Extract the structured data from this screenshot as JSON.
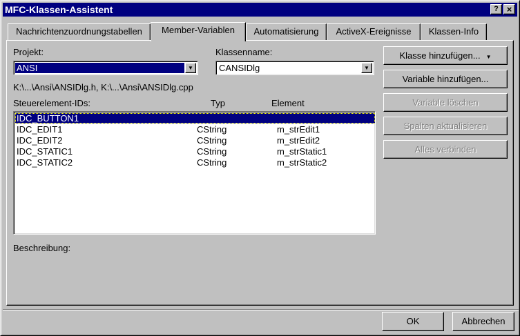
{
  "window": {
    "title": "MFC-Klassen-Assistent",
    "help_glyph": "?",
    "close_glyph": "×"
  },
  "tabs": [
    {
      "label": "Nachrichtenzuordnungstabellen",
      "active": false
    },
    {
      "label": "Member-Variablen",
      "active": true
    },
    {
      "label": "Automatisierung",
      "active": false
    },
    {
      "label": "ActiveX-Ereignisse",
      "active": false
    },
    {
      "label": "Klassen-Info",
      "active": false
    }
  ],
  "form": {
    "project_label": "Projekt:",
    "project_value": "ANSI",
    "class_label": "Klassenname:",
    "class_value": "CANSIDlg",
    "files_path": "K:\\...\\Ansi\\ANSIDlg.h, K:\\...\\Ansi\\ANSIDlg.cpp",
    "description_label": "Beschreibung:"
  },
  "list": {
    "headers": {
      "id": "Steuerelement-IDs:",
      "type": "Typ",
      "member": "Element"
    },
    "rows": [
      {
        "id": "IDC_BUTTON1",
        "type": "",
        "member": "",
        "selected": true
      },
      {
        "id": "IDC_EDIT1",
        "type": "CString",
        "member": "m_strEdit1",
        "selected": false
      },
      {
        "id": "IDC_EDIT2",
        "type": "CString",
        "member": "m_strEdit2",
        "selected": false
      },
      {
        "id": "IDC_STATIC1",
        "type": "CString",
        "member": "m_strStatic1",
        "selected": false
      },
      {
        "id": "IDC_STATIC2",
        "type": "CString",
        "member": "m_strStatic2",
        "selected": false
      }
    ]
  },
  "actions": {
    "add_class": "Klasse hinzufügen...",
    "add_class_caret": "▼",
    "add_variable": "Variable hinzufügen...",
    "delete_variable": "Variable löschen",
    "update_columns": "Spalten aktualisieren",
    "bind_all": "Alles verbinden"
  },
  "footer": {
    "ok": "OK",
    "cancel": "Abbrechen"
  },
  "icons": {
    "combo_arrow": "▼"
  }
}
